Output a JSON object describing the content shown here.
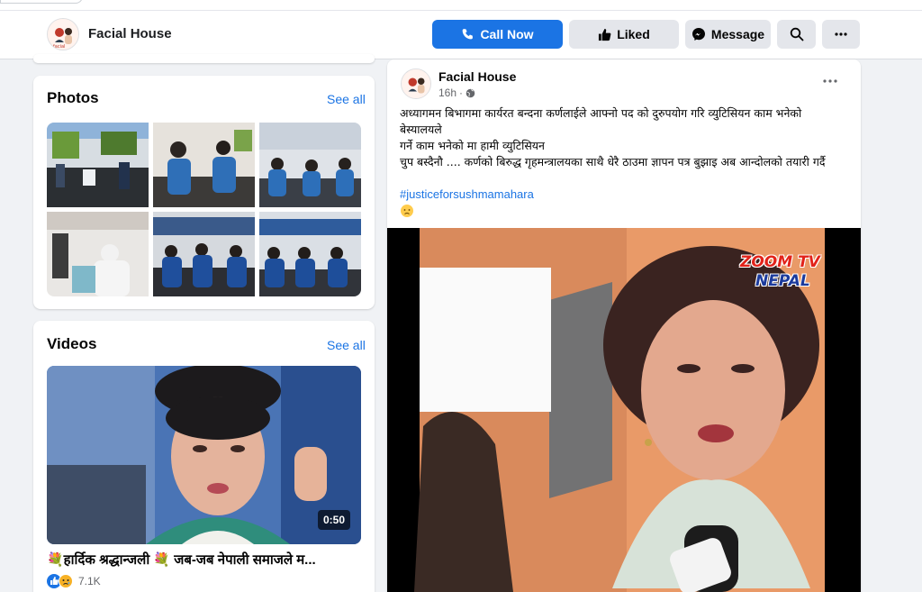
{
  "header": {
    "page_name": "Facial House",
    "buttons": {
      "call_now": "Call Now",
      "liked": "Liked",
      "message": "Message"
    },
    "icons": [
      "phone-icon",
      "thumbs-up-icon",
      "messenger-icon",
      "search-icon",
      "more-icon"
    ]
  },
  "photos": {
    "title": "Photos",
    "see_all": "See all",
    "count": 6
  },
  "videos": {
    "title": "Videos",
    "see_all": "See all",
    "featured": {
      "duration": "0:50",
      "title": "💐हार्दिक श्रद्धान्जली 💐 जब-जब नेपाली समाजले म...",
      "reaction_count": "7.1K",
      "reaction_icons": [
        "like-icon",
        "sad-icon"
      ]
    }
  },
  "post": {
    "author": "Facial House",
    "time": "16h",
    "privacy_icon": "globe-icon",
    "text_lines": [
      "अध्यागमन बिभागमा कार्यरत बन्दना कर्णलाईले आफ्नो पद को दुरुपयोग गरि  व्युटिसियन काम भनेको बेस्यालयले",
      "गर्ने काम भनेको मा हामी व्युटिसियन",
      "चुप बस्दैनौ .... कर्णको बिरुद्ध गृहमन्त्रालयका साथै धेरै ठाउमा  ज्ञापन पत्र बुझाइ अब आन्दोलको तयारी गर्दै"
    ],
    "hashtag": "#justiceforsushmamahara",
    "emoji": "sad-face",
    "media": {
      "logo_line1": "ZOOM TV",
      "logo_line2": "NEPAL"
    }
  },
  "colors": {
    "accent": "#1b74e4",
    "background": "#f0f2f5",
    "button_gray": "#e4e6eb"
  }
}
